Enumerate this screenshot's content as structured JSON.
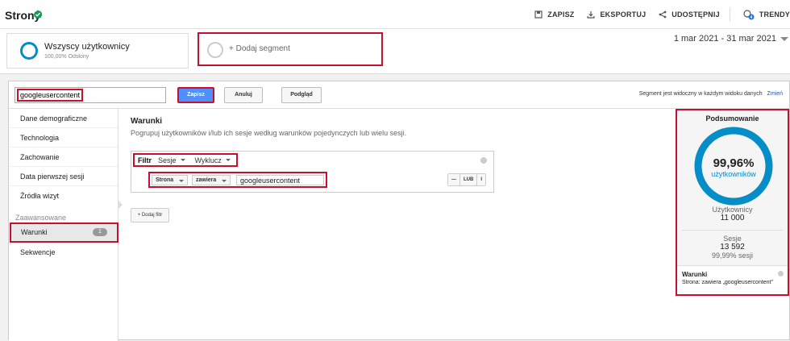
{
  "header": {
    "title": "Strony",
    "actions": [
      {
        "label": "ZAPISZ",
        "icon": "save-icon"
      },
      {
        "label": "EKSPORTUJ",
        "icon": "export-icon"
      },
      {
        "label": "UDOSTĘPNIJ",
        "icon": "share-icon"
      },
      {
        "label": "TRENDY",
        "icon": "insights-icon"
      }
    ]
  },
  "segments": {
    "active": {
      "title": "Wszyscy użytkownicy",
      "subtitle": "100,00% Odsłony"
    },
    "add_label": "+ Dodaj segment"
  },
  "date_range": "1 mar 2021 - 31 mar 2021",
  "editor": {
    "name_value": "googleusercontent",
    "save_label": "Zapisz",
    "cancel_label": "Anuluj",
    "preview_label": "Podgląd",
    "visibility_text": "Segment jest widoczny w każdym widoku danych",
    "change_label": "Zmień"
  },
  "nav": {
    "items": [
      "Dane demograficzne",
      "Technologia",
      "Zachowanie",
      "Data pierwszej sesji",
      "Źródła wizyt"
    ],
    "advanced_label": "Zaawansowane",
    "active_item": {
      "label": "Warunki",
      "badge": "1"
    },
    "sequences_label": "Sekwencje"
  },
  "conditions": {
    "title": "Warunki",
    "description": "Pogrupuj użytkowników i/lub ich sesje według warunków pojedynczych lub wielu sesji.",
    "filter": {
      "label": "Filtr",
      "scope": "Sesje",
      "mode": "Wyklucz",
      "dimension": "Strona",
      "operator": "zawiera",
      "value": "googleusercontent",
      "op_buttons": [
        "—",
        "LUB",
        "I"
      ]
    },
    "add_filter_label": "+ Dodaj filtr"
  },
  "summary": {
    "title": "Podsumowanie",
    "percent_text": "99,96%",
    "percent_value": 99.96,
    "percent_label": "użytkowników",
    "users_label": "Użytkownicy",
    "users_value": "11 000",
    "sessions_label": "Sesje",
    "sessions_value": "13 592",
    "sessions_pct": "99,99% sesji",
    "condition_title": "Warunki",
    "condition_desc": "Strona: zawiera „googleusercontent”"
  },
  "colors": {
    "accent": "#058dc7",
    "highlight": "#c8102e",
    "primary_button": "#4d90fe",
    "verified": "#0f9d58"
  }
}
